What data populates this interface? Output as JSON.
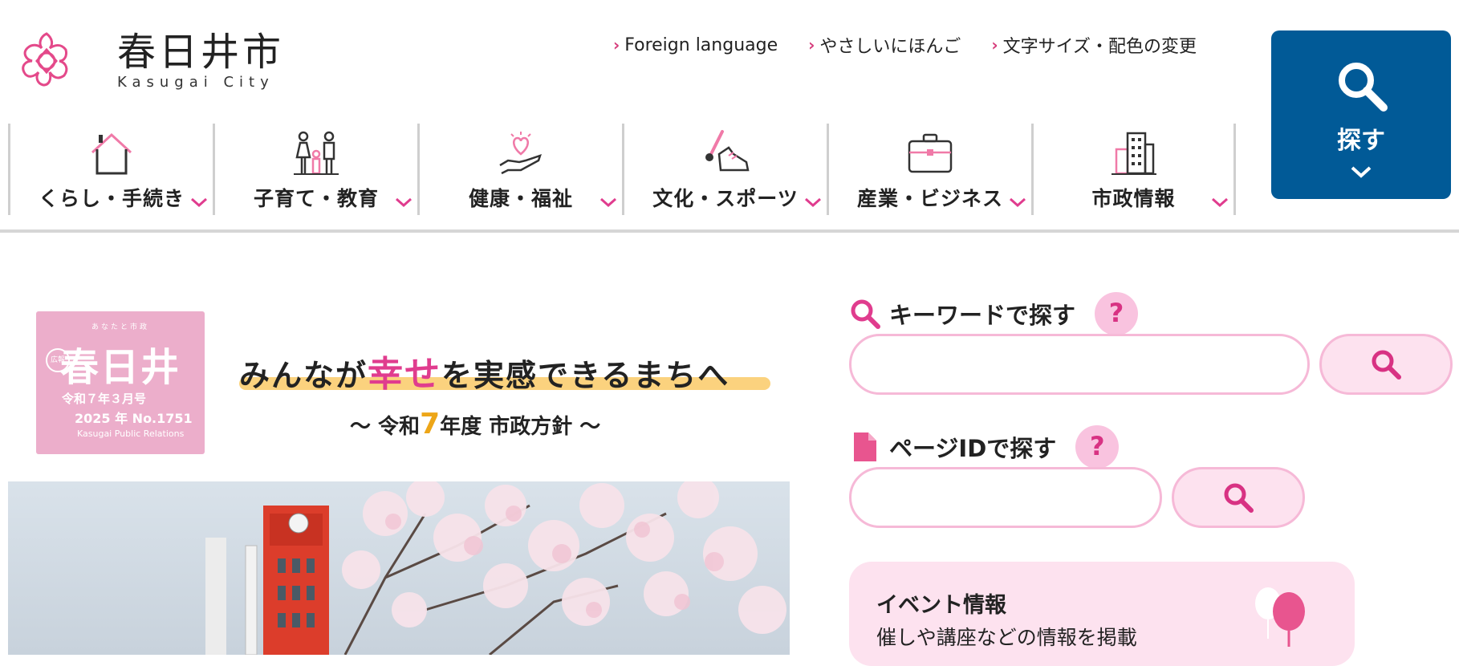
{
  "site": {
    "name": "春日井市",
    "name_en": "Kasugai City"
  },
  "utility_links": [
    {
      "label": "Foreign language"
    },
    {
      "label": "やさしいにほんご"
    },
    {
      "label": "文字サイズ・配色の変更"
    }
  ],
  "search_button": {
    "label": "探す",
    "icon": "search-icon"
  },
  "nav": [
    {
      "label": "くらし・手続き",
      "icon": "house-icon"
    },
    {
      "label": "子育て・教育",
      "icon": "family-icon"
    },
    {
      "label": "健康・福祉",
      "icon": "heart-hand-icon"
    },
    {
      "label": "文化・スポーツ",
      "icon": "brush-shoe-icon"
    },
    {
      "label": "産業・ビジネス",
      "icon": "briefcase-icon"
    },
    {
      "label": "市政情報",
      "icon": "building-icon"
    }
  ],
  "banner": {
    "badge": {
      "small": "あなたと市政",
      "title": "春日井",
      "ring": "広報",
      "issue": "令和７年３月号",
      "no": "2025 年  No.1751",
      "en": "Kasugai Public Relations"
    },
    "headline_pre": "みんなが",
    "headline_em": "幸せ",
    "headline_post": "を実感できるまちへ",
    "sub_pre": "〜 令和",
    "sub_num": "7",
    "sub_post": "年度 市政方針 〜"
  },
  "keyword_search": {
    "label": "キーワードで探す",
    "help": "?",
    "value": ""
  },
  "pageid_search": {
    "label": "ページIDで探す",
    "help": "?",
    "value": ""
  },
  "event_card": {
    "title": "イベント情報",
    "desc": "催しや講座などの情報を掲載"
  },
  "colors": {
    "accent_pink": "#e03c8e",
    "search_blue": "#015a97",
    "soft_pink": "#fde2ef"
  }
}
